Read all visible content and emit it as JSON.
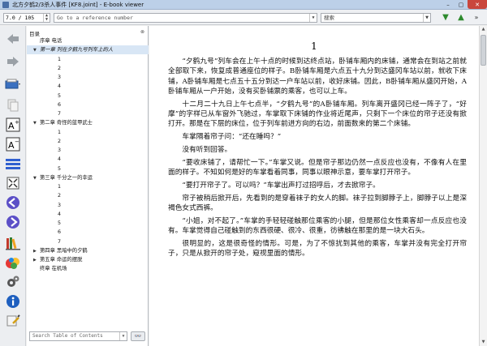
{
  "window": {
    "title": "北方夕鹤2/3杀人事件 [KF8.joint] - E-book viewer",
    "minimize": "–",
    "maximize": "▢",
    "close": "✕"
  },
  "toolbar": {
    "position": "7.0 / 105",
    "reference_placeholder": "Go to a reference number",
    "search_placeholder": "搜索"
  },
  "toc": {
    "header": "目录",
    "close_label": "⊗",
    "search_placeholder": "Search Table of Contents",
    "search_button": "👓",
    "items": [
      {
        "label": "序章 电话",
        "level": 1,
        "expander": "",
        "italic": false,
        "selected": false
      },
      {
        "label": "第一章 列在夕鹤九号列车上的人",
        "level": 1,
        "expander": "▼",
        "italic": true,
        "selected": true
      },
      {
        "label": "1",
        "level": 2,
        "expander": "",
        "italic": false,
        "selected": false
      },
      {
        "label": "2",
        "level": 2,
        "expander": "",
        "italic": false,
        "selected": false
      },
      {
        "label": "3",
        "level": 2,
        "expander": "",
        "italic": false,
        "selected": false
      },
      {
        "label": "4",
        "level": 2,
        "expander": "",
        "italic": false,
        "selected": false
      },
      {
        "label": "5",
        "level": 2,
        "expander": "",
        "italic": false,
        "selected": false
      },
      {
        "label": "6",
        "level": 2,
        "expander": "",
        "italic": false,
        "selected": false
      },
      {
        "label": "7",
        "level": 2,
        "expander": "",
        "italic": false,
        "selected": false
      },
      {
        "label": "第二章 奇怪的蓝甲武士",
        "level": 1,
        "expander": "▼",
        "italic": false,
        "selected": false
      },
      {
        "label": "1",
        "level": 2,
        "expander": "",
        "italic": false,
        "selected": false
      },
      {
        "label": "2",
        "level": 2,
        "expander": "",
        "italic": false,
        "selected": false
      },
      {
        "label": "3",
        "level": 2,
        "expander": "",
        "italic": false,
        "selected": false
      },
      {
        "label": "4",
        "level": 2,
        "expander": "",
        "italic": false,
        "selected": false
      },
      {
        "label": "5",
        "level": 2,
        "expander": "",
        "italic": false,
        "selected": false
      },
      {
        "label": "第三章 千分之一的幸运",
        "level": 1,
        "expander": "▼",
        "italic": false,
        "selected": false
      },
      {
        "label": "1",
        "level": 2,
        "expander": "",
        "italic": false,
        "selected": false
      },
      {
        "label": "2",
        "level": 2,
        "expander": "",
        "italic": false,
        "selected": false
      },
      {
        "label": "3",
        "level": 2,
        "expander": "",
        "italic": false,
        "selected": false
      },
      {
        "label": "4",
        "level": 2,
        "expander": "",
        "italic": false,
        "selected": false
      },
      {
        "label": "5",
        "level": 2,
        "expander": "",
        "italic": false,
        "selected": false
      },
      {
        "label": "6",
        "level": 2,
        "expander": "",
        "italic": false,
        "selected": false
      },
      {
        "label": "7",
        "level": 2,
        "expander": "",
        "italic": false,
        "selected": false
      },
      {
        "label": "第四章 黑暗中的夕鹤",
        "level": 1,
        "expander": "▶",
        "italic": false,
        "selected": false
      },
      {
        "label": "第五章 命运的摆脱",
        "level": 1,
        "expander": "▶",
        "italic": false,
        "selected": false
      },
      {
        "label": "终章 在机场",
        "level": 1,
        "expander": "",
        "italic": false,
        "selected": false
      }
    ]
  },
  "book": {
    "section_number": "1",
    "paragraphs": [
      "“夕鹤九号”列车会在上午十点的时候到达终点站，卧铺车厢内的床铺，通常会在到站之前就全部取下来，恢复成普通座位的样子。B卧铺车厢是六点五十九分到达盛冈车站以前，就收下床铺，A卧铺车厢是七点五十五分到达一户车站以前，收好床铺。因此，B卧铺车厢从盛冈开始，A卧铺车厢从一户开始，没有买卧铺票的乘客，也可以上车。",
      "十二月二十九日上午七点半，“夕鹤九号”的A卧铺车厢。列车离开盛冈已经一阵子了，“好摩”的字样已从车窗外飞驰过，车掌取下床铺的作业将近尾声，只剩下一个床位的帘子还没有掀打开。那是在下层的床位，位于列车前进方向的右边，前面数来的第二个床铺。",
      "车掌隔着帘子问：“还在睡吗？”",
      "没有听到回答。",
      "“要收床铺了，请帮忙一下。”车掌又说。但是帘子那边仍然一点反应也没有，不像有人在里面的样子。不知如何是好的车掌看着同事，同事以眼神示意，要车掌打开帘子。",
      "“要打开帘子了。可以吗？”车掌出声打过招呼后，才去掀帘子。",
      "帘子被稍后掀开后，先看到的是穿着袜子的女人的脚。袜子拉到脚脖子上，脚脖子以上是深褐色女式西裤。",
      "“小姐，对不起了。”车掌的手轻轻碰触那位乘客的小腿，但是那位女性乘客却一点反应也没有。车掌觉得自己碰触到的东西很硬、很冷、很重，彷彿触在那里的是一块大石头。",
      "很明显的，这是很奇怪的情形。可是，为了不惊扰到其他的乘客，车掌并没有完全打开帘子，只是从掀开的帘子处，窥视里面的情形。"
    ]
  },
  "colors": {
    "accent_green": "#2d8a2d",
    "selection": "#d8e6f5",
    "close_red": "#c9463d"
  },
  "icons": [
    "back-arrow-icon",
    "forward-arrow-icon",
    "open-book-icon",
    "copy-icon",
    "font-larger-icon",
    "font-smaller-icon",
    "toc-icon",
    "fullscreen-icon",
    "previous-chapter-icon",
    "next-chapter-icon",
    "library-icon",
    "bookmark-icon",
    "preferences-icon",
    "info-icon",
    "lookup-icon"
  ]
}
